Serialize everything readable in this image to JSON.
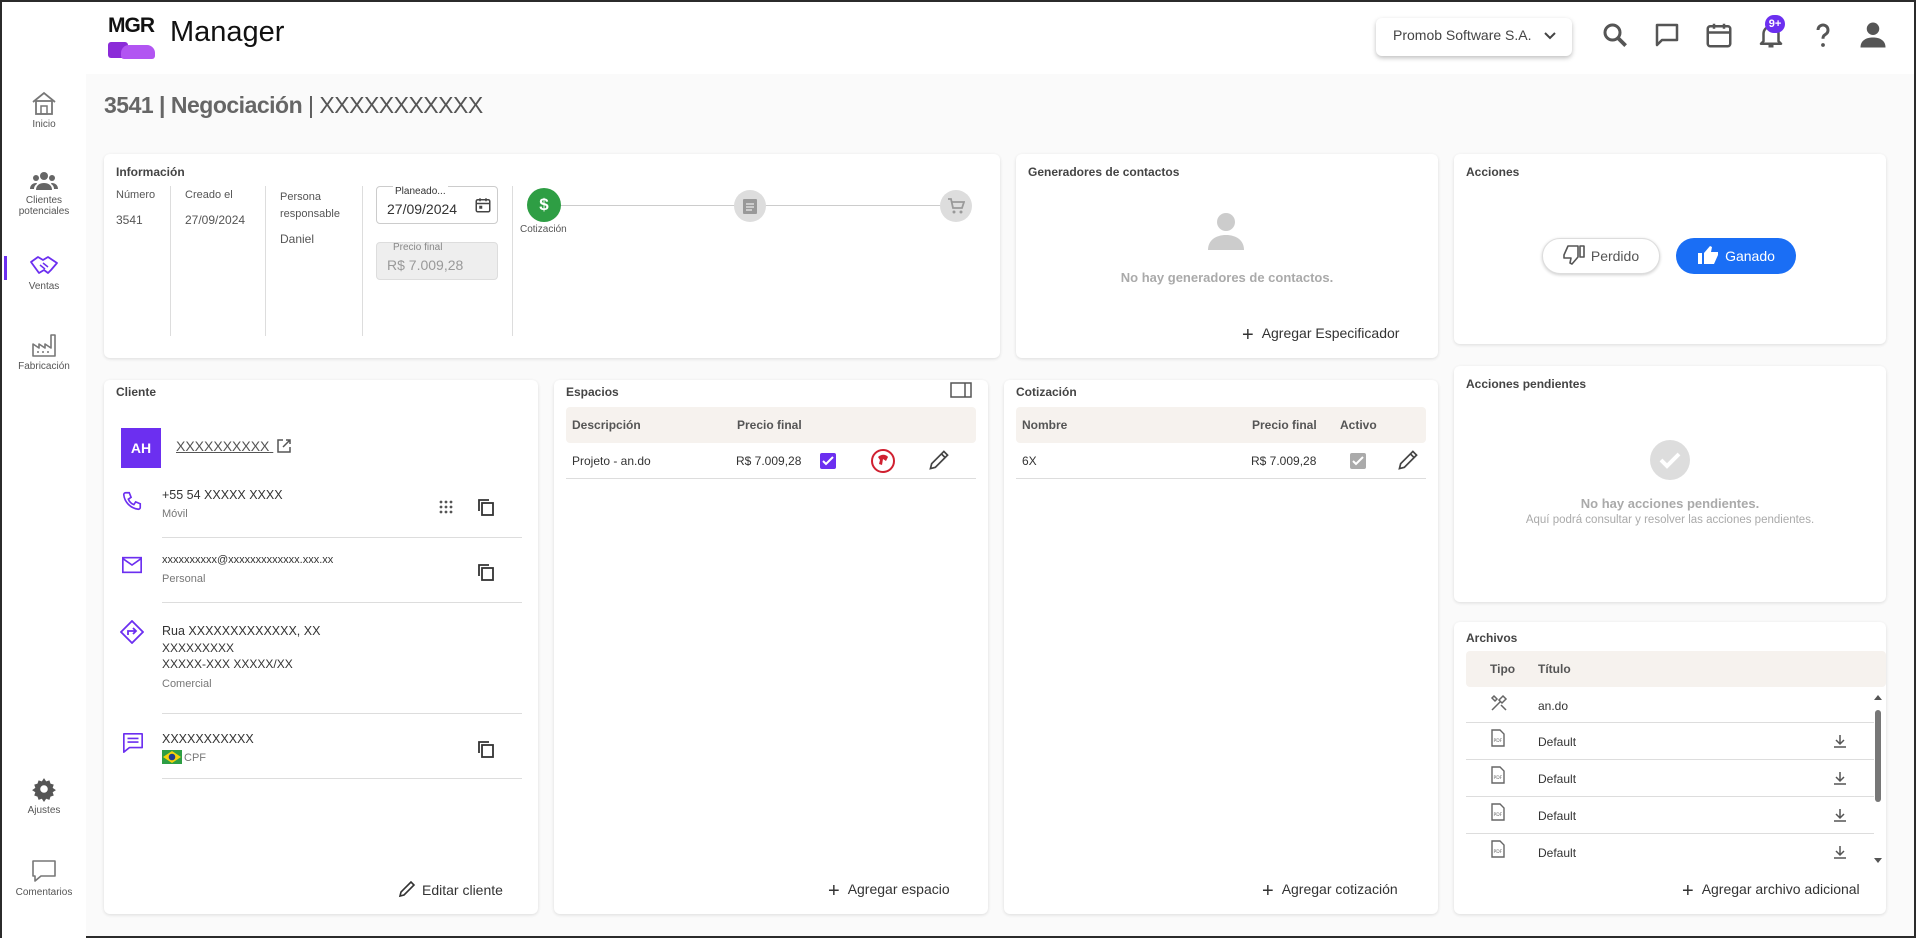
{
  "header": {
    "logo_text": "MGR",
    "app_name": "Manager",
    "company": "Promob Software S.A.",
    "notifications_badge": "9+"
  },
  "sidebar": {
    "items": [
      {
        "label": "Inicio"
      },
      {
        "label": "Clientes potenciales"
      },
      {
        "label": "Ventas"
      },
      {
        "label": "Fabricación"
      }
    ],
    "bottom": [
      {
        "label": "Ajustes"
      },
      {
        "label": "Comentarios"
      }
    ]
  },
  "page": {
    "id": "3541",
    "type": "Negociación",
    "client": "XXXXXXXXXXX"
  },
  "info": {
    "title": "Información",
    "numero_label": "Número",
    "numero": "3541",
    "creado_label": "Creado el",
    "creado": "27/09/2024",
    "persona_label": "Persona responsable",
    "persona": "Daniel",
    "planeado_label": "Planeado...",
    "planeado": "27/09/2024",
    "precio_label": "Precio final",
    "precio": "R$ 7.009,28",
    "steps": [
      {
        "label": "Cotización",
        "status": "active"
      },
      {
        "label": "",
        "status": "pending"
      },
      {
        "label": "",
        "status": "pending"
      }
    ]
  },
  "generadores": {
    "title": "Generadores de contactos",
    "empty_text": "No hay generadores de contactos.",
    "add_label": "Agregar Especificador"
  },
  "acciones": {
    "title": "Acciones",
    "perdido_label": "Perdido",
    "ganado_label": "Ganado"
  },
  "pendientes": {
    "title": "Acciones pendientes",
    "empty_title": "No hay acciones pendientes.",
    "empty_sub": "Aquí podrá consultar y resolver las acciones pendientes."
  },
  "cliente": {
    "title": "Cliente",
    "initials": "AH",
    "name": "XXXXXXXXXX",
    "phone": "+55 54 XXXXX XXXX",
    "phone_type": "Móvil",
    "email": "xxxxxxxxxx@xxxxxxxxxxxxx.xxx.xx",
    "email_type": "Personal",
    "address_line1": "Rua XXXXXXXXXXXXX, XX",
    "address_line2": "XXXXXXXXX",
    "address_line3": "XXXXX-XXX  XXXXX/XX",
    "address_type": "Comercial",
    "doc": "XXXXXXXXXXX",
    "doc_type": "CPF",
    "edit_label": "Editar cliente"
  },
  "espacios": {
    "title": "Espacios",
    "col_desc": "Descripción",
    "col_precio": "Precio final",
    "rows": [
      {
        "desc": "Projeto - an.do",
        "precio": "R$ 7.009,28",
        "checked": true
      }
    ],
    "add_label": "Agregar espacio"
  },
  "cotizacion": {
    "title": "Cotización",
    "col_nombre": "Nombre",
    "col_precio": "Precio final",
    "col_activo": "Activo",
    "rows": [
      {
        "nombre": "6X",
        "precio": "R$ 7.009,28",
        "activo": true
      }
    ],
    "add_label": "Agregar cotización"
  },
  "archivos": {
    "title": "Archivos",
    "col_tipo": "Tipo",
    "col_titulo": "Título",
    "rows": [
      {
        "tipo": "tool",
        "titulo": "an.do"
      },
      {
        "tipo": "pdf",
        "titulo": "Default"
      },
      {
        "tipo": "pdf",
        "titulo": "Default"
      },
      {
        "tipo": "pdf",
        "titulo": "Default"
      },
      {
        "tipo": "pdf",
        "titulo": "Default"
      }
    ],
    "add_label": "Agregar archivo adicional"
  },
  "colors": {
    "accent": "#6c2ff0",
    "primary_blue": "#1a6ef5",
    "success_green": "#2e9e44"
  }
}
